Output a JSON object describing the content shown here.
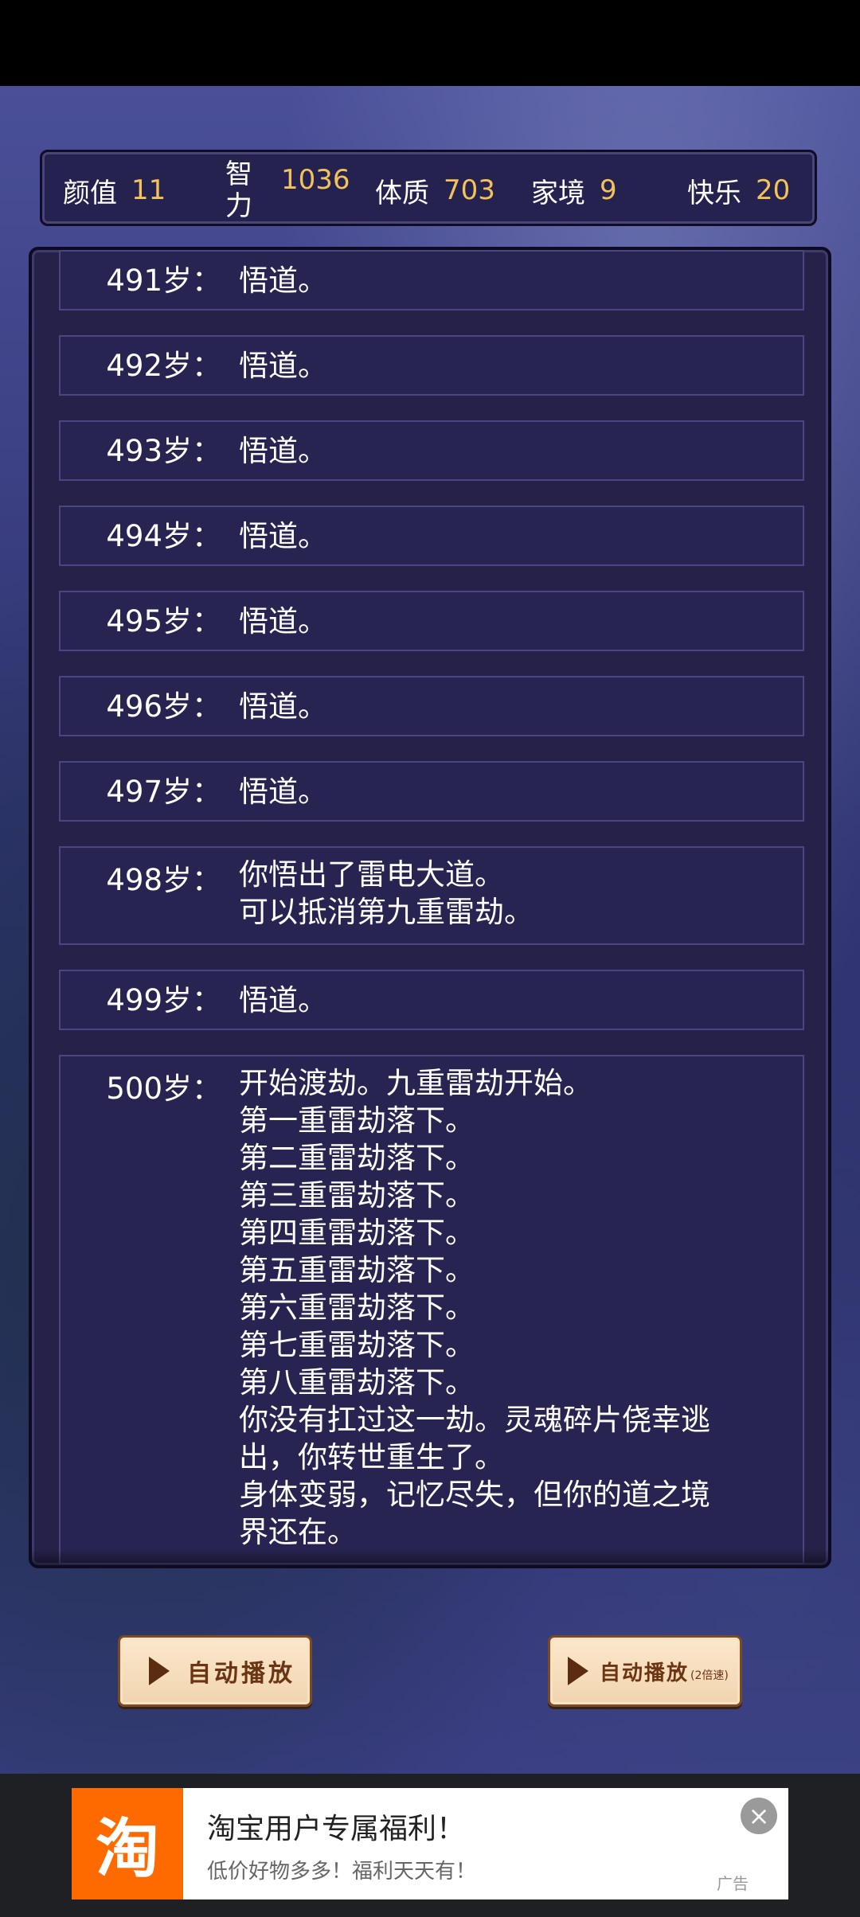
{
  "stats": [
    {
      "label": "颜值",
      "value": "11"
    },
    {
      "label": "智力",
      "value": "1036"
    },
    {
      "label": "体质",
      "value": "703"
    },
    {
      "label": "家境",
      "value": "9"
    },
    {
      "label": "快乐",
      "value": "20"
    }
  ],
  "events": [
    {
      "age": "491岁：",
      "text": "悟道。"
    },
    {
      "age": "492岁：",
      "text": "悟道。"
    },
    {
      "age": "493岁：",
      "text": "悟道。"
    },
    {
      "age": "494岁：",
      "text": "悟道。"
    },
    {
      "age": "495岁：",
      "text": "悟道。"
    },
    {
      "age": "496岁：",
      "text": "悟道。"
    },
    {
      "age": "497岁：",
      "text": "悟道。"
    },
    {
      "age": "498岁：",
      "lines": [
        "你悟出了雷电大道。",
        "可以抵消第九重雷劫。"
      ]
    },
    {
      "age": "499岁：",
      "text": "悟道。"
    },
    {
      "age": "500岁：",
      "lines": [
        "开始渡劫。九重雷劫开始。",
        "第一重雷劫落下。",
        "第二重雷劫落下。",
        "第三重雷劫落下。",
        "第四重雷劫落下。",
        "第五重雷劫落下。",
        "第六重雷劫落下。",
        "第七重雷劫落下。",
        "第八重雷劫落下。",
        "你没有扛过这一劫。灵魂碎片侥幸逃",
        "出，你转世重生了。",
        "身体变弱，记忆尽失，但你的道之境",
        "界还在。"
      ]
    }
  ],
  "buttons": {
    "auto_play": "自动播放",
    "auto_play_fast": "自动播放",
    "auto_play_fast_sub": "(2倍速)"
  },
  "ad": {
    "logo": "淘",
    "title": "淘宝用户专属福利！",
    "subtitle": "低价好物多多！福利天天有！",
    "tag": "广告",
    "close": "×"
  },
  "colors": {
    "stat_value": "#f2c35b",
    "panel": "#262148",
    "row": "#282452",
    "button": "#f1d4ae"
  }
}
